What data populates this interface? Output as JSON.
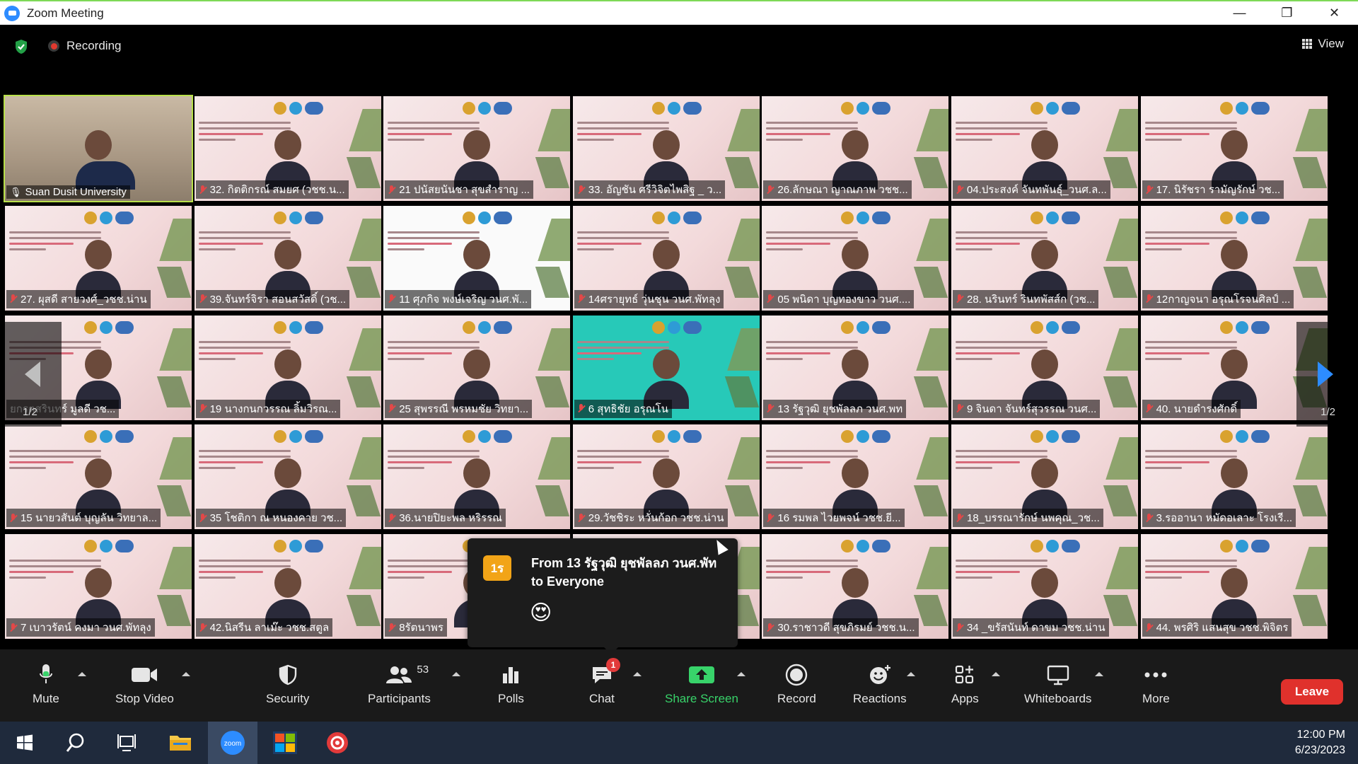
{
  "window": {
    "title": "Zoom Meeting",
    "minimize": "—",
    "restore": "❐",
    "close": "✕"
  },
  "topbar": {
    "recording_label": "Recording",
    "view_label": "View"
  },
  "gallery": {
    "page_indicator_left": "1/2",
    "page_indicator_right": "1/2",
    "tiles": [
      {
        "label": "Suan Dusit University",
        "muted": false
      },
      {
        "label": "32. กิตติกรณ์ สมยศ (วชช.น...",
        "muted": true
      },
      {
        "label": "21 ปนัสยนันชา สุขสำราญ ...",
        "muted": true
      },
      {
        "label": "33. อัญชัน ศรีวิจิตไพสิฐ _ ว...",
        "muted": true
      },
      {
        "label": "26.ลักษณา ญาณภาพ วชช...",
        "muted": true
      },
      {
        "label": "04.ประสงค์ จันทพันธุ์_วนศ.ล...",
        "muted": true
      },
      {
        "label": "17. นิรัชรา รามัญรักษ์ วช...",
        "muted": true
      },
      {
        "label": "27. ผุสดี สายวงศ์_วชช.น่าน",
        "muted": true
      },
      {
        "label": "39.จันทร์จิรา สอนสวัสดิ์ (วช...",
        "muted": true
      },
      {
        "label": "11 ศุภกิจ พงษ์เจริญ วนศ.พั...",
        "muted": true
      },
      {
        "label": "14ศรายุทธ์ วุ่นชุน วนศ.พัทลุง",
        "muted": true
      },
      {
        "label": "05 พนิดา บุญทองขาว วนศ....",
        "muted": true
      },
      {
        "label": "28. นรินทร์ รินทพัสส์ก (วช...",
        "muted": true
      },
      {
        "label": "12กาญจนา อรุณโรจนศิลป์ ...",
        "muted": true
      },
      {
        "label": "ยกรตสรินทร์ มูลดี วช...",
        "muted": false
      },
      {
        "label": "19 นางกนกวรรณ ลิ้มวิรณ...",
        "muted": true
      },
      {
        "label": "25 สุพรรณี พรหมชัย วิทยา...",
        "muted": true
      },
      {
        "label": "6 สุทธิชัย อรุณโน",
        "muted": true
      },
      {
        "label": "13 รัฐวุฒิ ยุชพัลลภ วนศ.พท",
        "muted": true
      },
      {
        "label": "9 จินดา จันทร์สุวรรณ วนศ...",
        "muted": true
      },
      {
        "label": "40. นายดำรงศักดิ์",
        "muted": true
      },
      {
        "label": "15 นายวสันต์ บุญลัน วิทยาล...",
        "muted": true
      },
      {
        "label": "35 โชติกา ณ หนองคาย วช...",
        "muted": true
      },
      {
        "label": "36.นายปิยะพล หริรรณ",
        "muted": true
      },
      {
        "label": "29.วัชชิระ หวั่นก้อก วชช.น่าน",
        "muted": true
      },
      {
        "label": "16 รมพล ไวยพจน์ วชช.ยี...",
        "muted": true
      },
      {
        "label": "18_บรรณารักษ์ นพคุณ_วช...",
        "muted": true
      },
      {
        "label": "3.รออานา หมัดอเลาะ โรงเรี...",
        "muted": true
      },
      {
        "label": "7 เบาวรัตน์ คงมา วนศ.พัทลุง",
        "muted": true
      },
      {
        "label": "42.นิสรีน ลาเม๊ะ วชช.สตูล",
        "muted": true
      },
      {
        "label": "8รัตนาพร",
        "muted": true
      },
      {
        "label": "",
        "muted": true
      },
      {
        "label": "30.ราชาวดี สุขภิรมย์ วชช.น...",
        "muted": true
      },
      {
        "label": "34 _ขรัสนันท์ ดาขม วชช.น่าน",
        "muted": true
      },
      {
        "label": "44. พรศิริ แสนสุข วชช.พิจิตร",
        "muted": true
      }
    ]
  },
  "chat_popup": {
    "avatar_text": "1ร",
    "from_line": "From 13 รัฐวุฒิ ยุชพัลลภ วนศ.พัท",
    "to_line": "to Everyone",
    "message": "😍"
  },
  "toolbar": {
    "mute": "Mute",
    "stop_video": "Stop Video",
    "security": "Security",
    "participants": "Participants",
    "participants_count": "53",
    "polls": "Polls",
    "chat": "Chat",
    "chat_badge": "1",
    "share_screen": "Share Screen",
    "record": "Record",
    "reactions": "Reactions",
    "apps": "Apps",
    "whiteboards": "Whiteboards",
    "more": "More",
    "leave": "Leave",
    "share_color": "#38d36a",
    "leave_color": "#e0312c"
  },
  "taskbar": {
    "time": "12:00 PM",
    "date": "6/23/2023"
  }
}
